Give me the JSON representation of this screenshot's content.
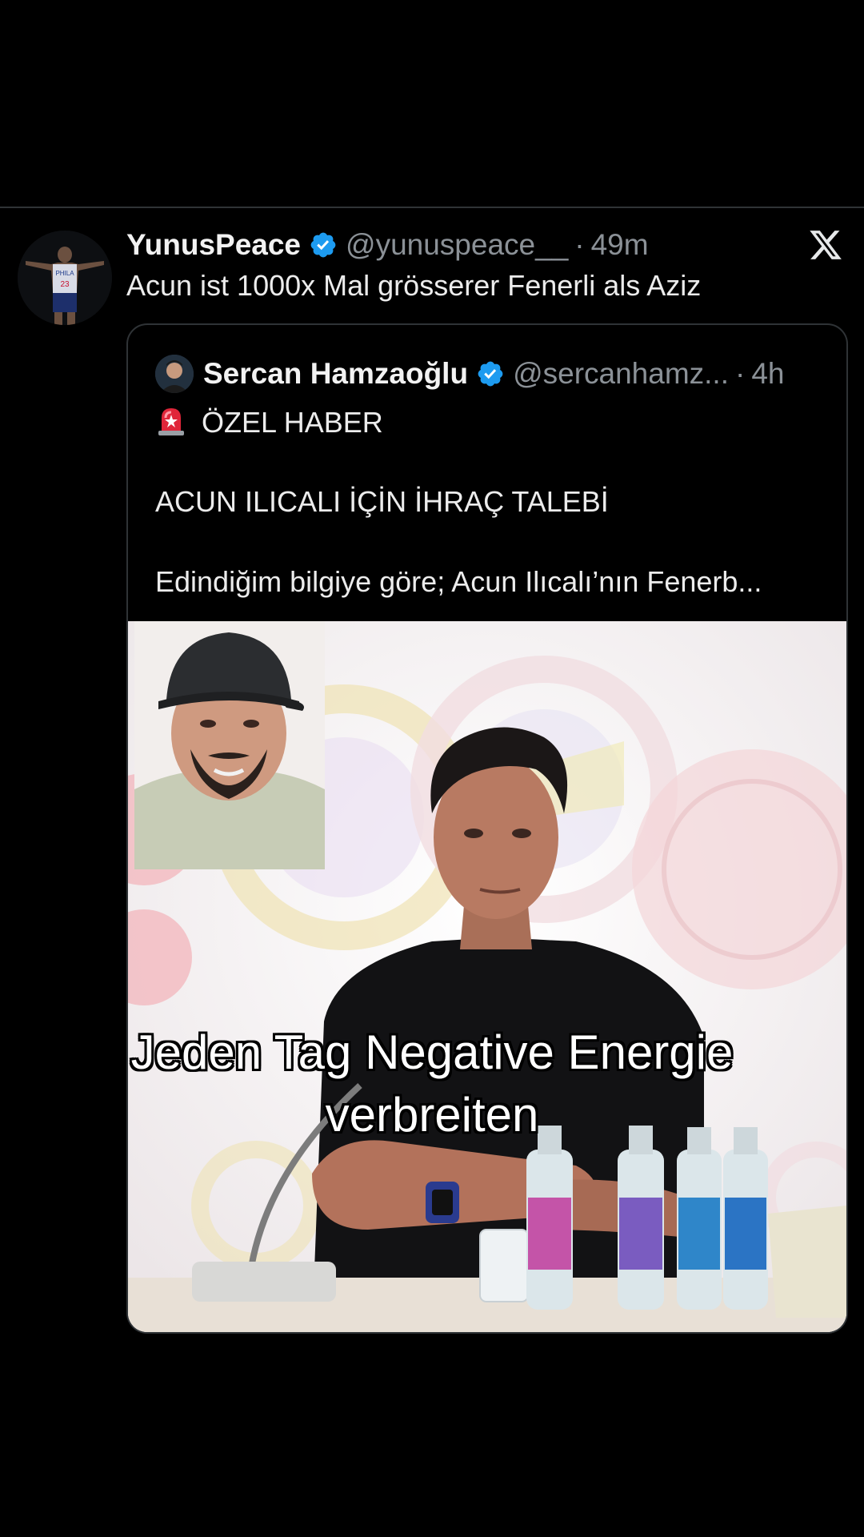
{
  "tweet": {
    "display_name": "YunusPeace",
    "handle": "@yunuspeace__",
    "separator": "·",
    "time": "49m",
    "text": "Acun ist 1000x Mal grösserer Fenerli als Aziz"
  },
  "quoted_tweet": {
    "display_name": "Sercan Hamzaoğlu",
    "handle": "@sercanhamz...",
    "separator": "·",
    "time": "4h",
    "line1": "ÖZEL HABER",
    "line2": "ACUN ILICALI İÇİN İHRAÇ TALEBİ",
    "line3": "Edindiğim bilgiye göre; Acun Ilıcalı’nın Fenerb..."
  },
  "caption": {
    "line1": "Jeden Tag Negative Energie",
    "line2": "verbreiten"
  },
  "colors": {
    "background": "#000000",
    "verified_blue": "#1d9bf0",
    "muted_text": "#8b9197",
    "divider": "#2f3336"
  },
  "icons": {
    "verified": "verified-badge-icon",
    "close": "x-logo-icon",
    "siren": "police-light-emoji"
  }
}
